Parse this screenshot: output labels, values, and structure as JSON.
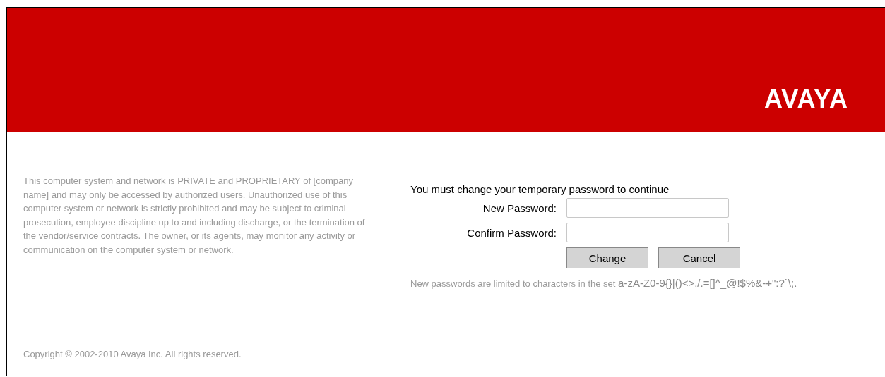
{
  "header": {
    "logo": "AVAYA"
  },
  "disclaimer": "This computer system and network is PRIVATE and PROPRIETARY of [company name] and may only be accessed by authorized users. Unauthorized use of this computer system or network is strictly prohibited and may be subject to criminal prosecution, employee discipline up to and including discharge, or the termination of the vendor/service contracts. The owner, or its agents, may monitor any activity or communication on the computer system or network.",
  "form": {
    "title": "You must change your temporary password to continue",
    "fields": [
      {
        "label": "New Password:"
      },
      {
        "label": "Confirm Password:"
      }
    ],
    "buttons": [
      "Change",
      "Cancel"
    ],
    "rule": "New passwords are limited to characters in the set **a-zA-Z0-9{}|()<>,/.=[]^_@!$%&-+\":?`\\;.**"
  },
  "copyright": "Copyright © 2002-2010 Avaya Inc. All rights reserved."
}
